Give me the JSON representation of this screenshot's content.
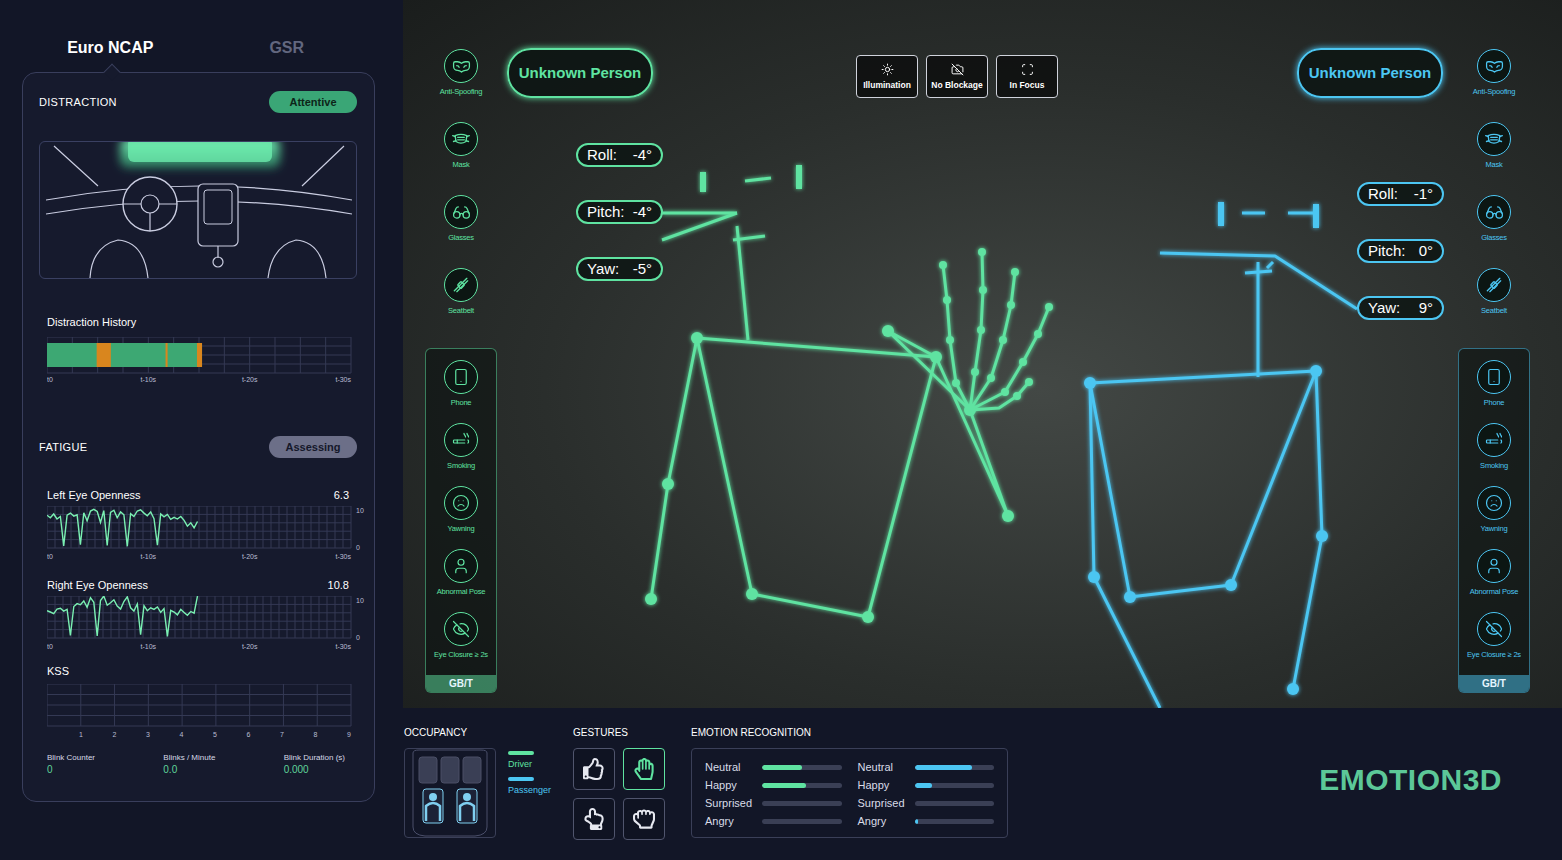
{
  "tabs": [
    {
      "label": "Euro NCAP",
      "selected": true
    },
    {
      "label": "GSR",
      "selected": false
    }
  ],
  "distraction": {
    "title": "DISTRACTION",
    "status": "Attentive",
    "state": "attentive",
    "active_zone": "windshield",
    "history": {
      "title": "Distraction History",
      "ticks": [
        "t0",
        "t-10s",
        "t-20s",
        "t-30s"
      ],
      "span_s": 30,
      "recorded_s": 15.3,
      "events": [
        {
          "from": 4.9,
          "to": 6.3
        },
        {
          "from": 11.7,
          "to": 11.9
        },
        {
          "from": 14.8,
          "to": 15.3
        }
      ]
    }
  },
  "fatigue": {
    "title": "FATIGUE",
    "status": "Assessing",
    "state": "assessing",
    "eyes": [
      {
        "label": "Left Eye Openness",
        "value": "6.3",
        "axis_max": "10",
        "axis_min": "0",
        "span_s": 30,
        "sample_interval_s": 0.33,
        "ticks": [
          "t0",
          "t-10s",
          "t-20s",
          "t-30s"
        ],
        "values": [
          7.8,
          7.2,
          8.1,
          6.9,
          7.5,
          0.5,
          7.8,
          8.3,
          7.6,
          7.9,
          0.8,
          8.4,
          6.5,
          8.8,
          9.2,
          8.7,
          6.1,
          8.9,
          0.6,
          8.5,
          9.0,
          7.2,
          8.6,
          7.9,
          0.4,
          8.2,
          7.5,
          8.8,
          9.1,
          8.3,
          7.7,
          8.6,
          7.0,
          0.7,
          8.1,
          7.4,
          8.0,
          6.8,
          7.3,
          6.9,
          7.5,
          6.6,
          5.2,
          6.0,
          4.8,
          6.3
        ]
      },
      {
        "label": "Right Eye Openness",
        "value": "10.8",
        "axis_max": "10",
        "axis_min": "0",
        "span_s": 30,
        "sample_interval_s": 0.33,
        "ticks": [
          "t0",
          "t-10s",
          "t-20s",
          "t-30s"
        ],
        "values": [
          6.5,
          6.2,
          5.8,
          6.9,
          7.1,
          6.4,
          6.8,
          0.6,
          7.5,
          8.2,
          7.9,
          8.8,
          7.3,
          9.6,
          8.5,
          0.5,
          8.9,
          10.0,
          7.8,
          8.4,
          9.1,
          7.6,
          6.9,
          8.7,
          9.8,
          7.2,
          6.4,
          8.1,
          0.8,
          7.7,
          6.5,
          7.2,
          6.8,
          7.4,
          6.1,
          7.0,
          0.4,
          6.6,
          6.2,
          5.5,
          6.8,
          6.1,
          5.4,
          6.3,
          5.9,
          10.8
        ]
      }
    ],
    "kss": {
      "label": "KSS",
      "ticks": [
        "1",
        "2",
        "3",
        "4",
        "5",
        "6",
        "7",
        "8",
        "9"
      ]
    },
    "stats": [
      {
        "label": "Blink Counter",
        "value": "0"
      },
      {
        "label": "Blinks / Minute",
        "value": "0.0"
      },
      {
        "label": "Blink Duration (s)",
        "value": "0.000"
      }
    ]
  },
  "camera": {
    "checks": [
      {
        "label": "Illumination"
      },
      {
        "label": "No Blockage"
      },
      {
        "label": "In Focus"
      }
    ],
    "occupants": [
      {
        "role": "driver",
        "identity": "Unknown Person",
        "color": "#5fe3a1",
        "pose": [
          {
            "label": "Roll:",
            "value": "-4°"
          },
          {
            "label": "Pitch:",
            "value": "-4°"
          },
          {
            "label": "Yaw:",
            "value": "-5°"
          }
        ],
        "detectors": [
          {
            "label": "Anti-Spoofing"
          },
          {
            "label": "Mask"
          },
          {
            "label": "Glasses"
          },
          {
            "label": "Seatbelt"
          }
        ],
        "group": [
          {
            "label": "Phone"
          },
          {
            "label": "Smoking"
          },
          {
            "label": "Yawning"
          },
          {
            "label": "Abnormal Pose"
          },
          {
            "label": "Eye Closure ≥ 2s"
          }
        ],
        "standard": "GB/T"
      },
      {
        "role": "passenger",
        "identity": "Unknown Person",
        "color": "#4cc6f2",
        "pose": [
          {
            "label": "Roll:",
            "value": "-1°"
          },
          {
            "label": "Pitch:",
            "value": "0°"
          },
          {
            "label": "Yaw:",
            "value": "9°"
          }
        ],
        "detectors": [
          {
            "label": "Anti-Spoofing"
          },
          {
            "label": "Mask"
          },
          {
            "label": "Glasses"
          },
          {
            "label": "Seatbelt"
          }
        ],
        "group": [
          {
            "label": "Phone"
          },
          {
            "label": "Smoking"
          },
          {
            "label": "Yawning"
          },
          {
            "label": "Abnormal Pose"
          },
          {
            "label": "Eye Closure ≥ 2s"
          }
        ],
        "standard": "GB/T"
      }
    ]
  },
  "occupancy": {
    "title": "OCCUPANCY",
    "seats": [
      {
        "occupied": false,
        "color": "#4a4f66"
      },
      {
        "occupied": false,
        "color": "#4a4f66"
      },
      {
        "occupied": false,
        "color": "#4a4f66"
      },
      {
        "occupied": true,
        "color": "#7fcff0"
      },
      {
        "occupied": true,
        "color": "#7fcff0"
      }
    ],
    "legend": [
      {
        "label": "Driver",
        "color": "#5fe3a1"
      },
      {
        "label": "Passenger",
        "color": "#4cc6f2"
      }
    ]
  },
  "gestures": {
    "title": "GESTURES",
    "items": [
      {
        "kind": "thumbs-up",
        "selected": false
      },
      {
        "kind": "open-hand",
        "selected": true
      },
      {
        "kind": "point",
        "selected": false
      },
      {
        "kind": "fist",
        "selected": false
      }
    ]
  },
  "emotions": {
    "title": "EMOTION RECOGNITION",
    "columns": [
      {
        "color": "#5fe3a1",
        "items": [
          {
            "label": "Neutral",
            "level": 0.5
          },
          {
            "label": "Happy",
            "level": 0.55
          },
          {
            "label": "Surprised",
            "level": 0.0
          },
          {
            "label": "Angry",
            "level": 0.0
          }
        ]
      },
      {
        "color": "#4cc6f2",
        "items": [
          {
            "label": "Neutral",
            "level": 0.72
          },
          {
            "label": "Happy",
            "level": 0.22
          },
          {
            "label": "Surprised",
            "level": 0.0
          },
          {
            "label": "Angry",
            "level": 0.05
          }
        ]
      }
    ]
  },
  "logo": "EMOTION3D"
}
